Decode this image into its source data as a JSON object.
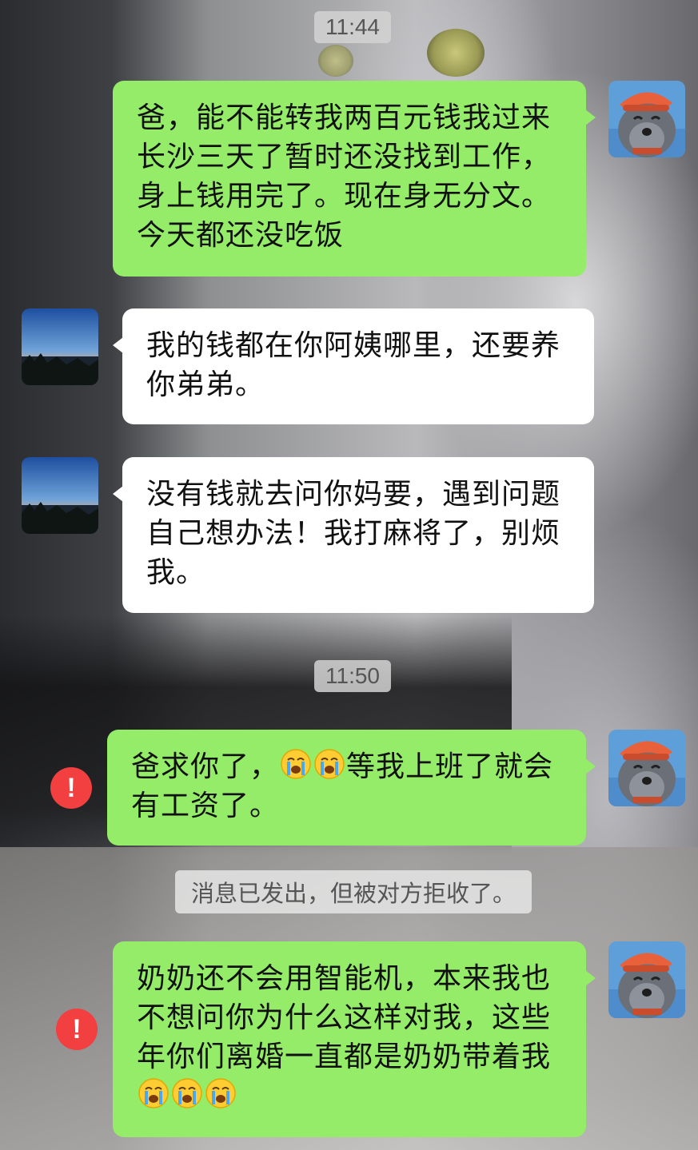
{
  "chat": {
    "timestamps": [
      "11:44",
      "11:50"
    ],
    "messages": [
      {
        "sender": "me",
        "text": "爸，能不能转我两百元钱我过来长沙三天了暂时还没找到工作，身上钱用完了。现在身无分文。今天都还没吃饭"
      },
      {
        "sender": "dad",
        "text": "我的钱都在你阿姨哪里，还要养你弟弟。"
      },
      {
        "sender": "dad",
        "text": "没有钱就去问你妈要，遇到问题自己想办法！我打麻将了，别烦我。"
      },
      {
        "sender": "me",
        "text_before": "爸求你了，",
        "text_after": "等我上班了就会有工资了。",
        "emojis": [
          "crying-face",
          "crying-face"
        ],
        "status": "!"
      },
      {
        "sender": "me",
        "text_before": "奶奶还不会用智能机，本来我也不想问你为什么这样对我，这些年你们离婚一直都是奶奶带着我",
        "emojis": [
          "crying-face",
          "crying-face",
          "crying-face"
        ],
        "status": "!"
      }
    ],
    "system_note": "消息已发出，但被对方拒收了。"
  },
  "colors": {
    "sent_bubble": "#95ec69",
    "received_bubble": "#ffffff",
    "error_red": "#f23f3f"
  },
  "icons": {
    "my_avatar": "gray-wolf-avatar",
    "dad_avatar": "sunset-landscape-avatar",
    "status": "exclamation-icon"
  }
}
